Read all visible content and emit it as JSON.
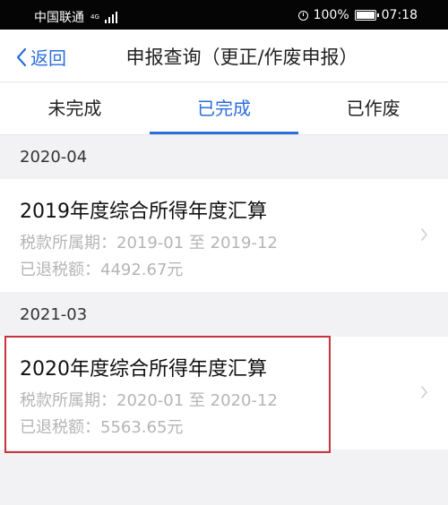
{
  "status_bar": {
    "carrier": "中国联通",
    "network": "4G",
    "battery": "100%",
    "time": "07:18"
  },
  "nav": {
    "back_label": "返回",
    "title": "申报查询（更正/作废申报）"
  },
  "tabs": [
    {
      "label": "未完成",
      "active": false
    },
    {
      "label": "已完成",
      "active": true
    },
    {
      "label": "已作废",
      "active": false
    }
  ],
  "records": [
    {
      "date": "2020-04",
      "title": "2019年度综合所得年度汇算",
      "period": "税款所属期：2019-01 至 2019-12",
      "refund": "已退税额：4492.67元"
    },
    {
      "date": "2021-03",
      "title": "2020年度综合所得年度汇算",
      "period": "税款所属期：2020-01 至 2020-12",
      "refund": "已退税额：5563.65元"
    }
  ],
  "colors": {
    "accent": "#2a6edb",
    "highlight_border": "#c8333b"
  }
}
